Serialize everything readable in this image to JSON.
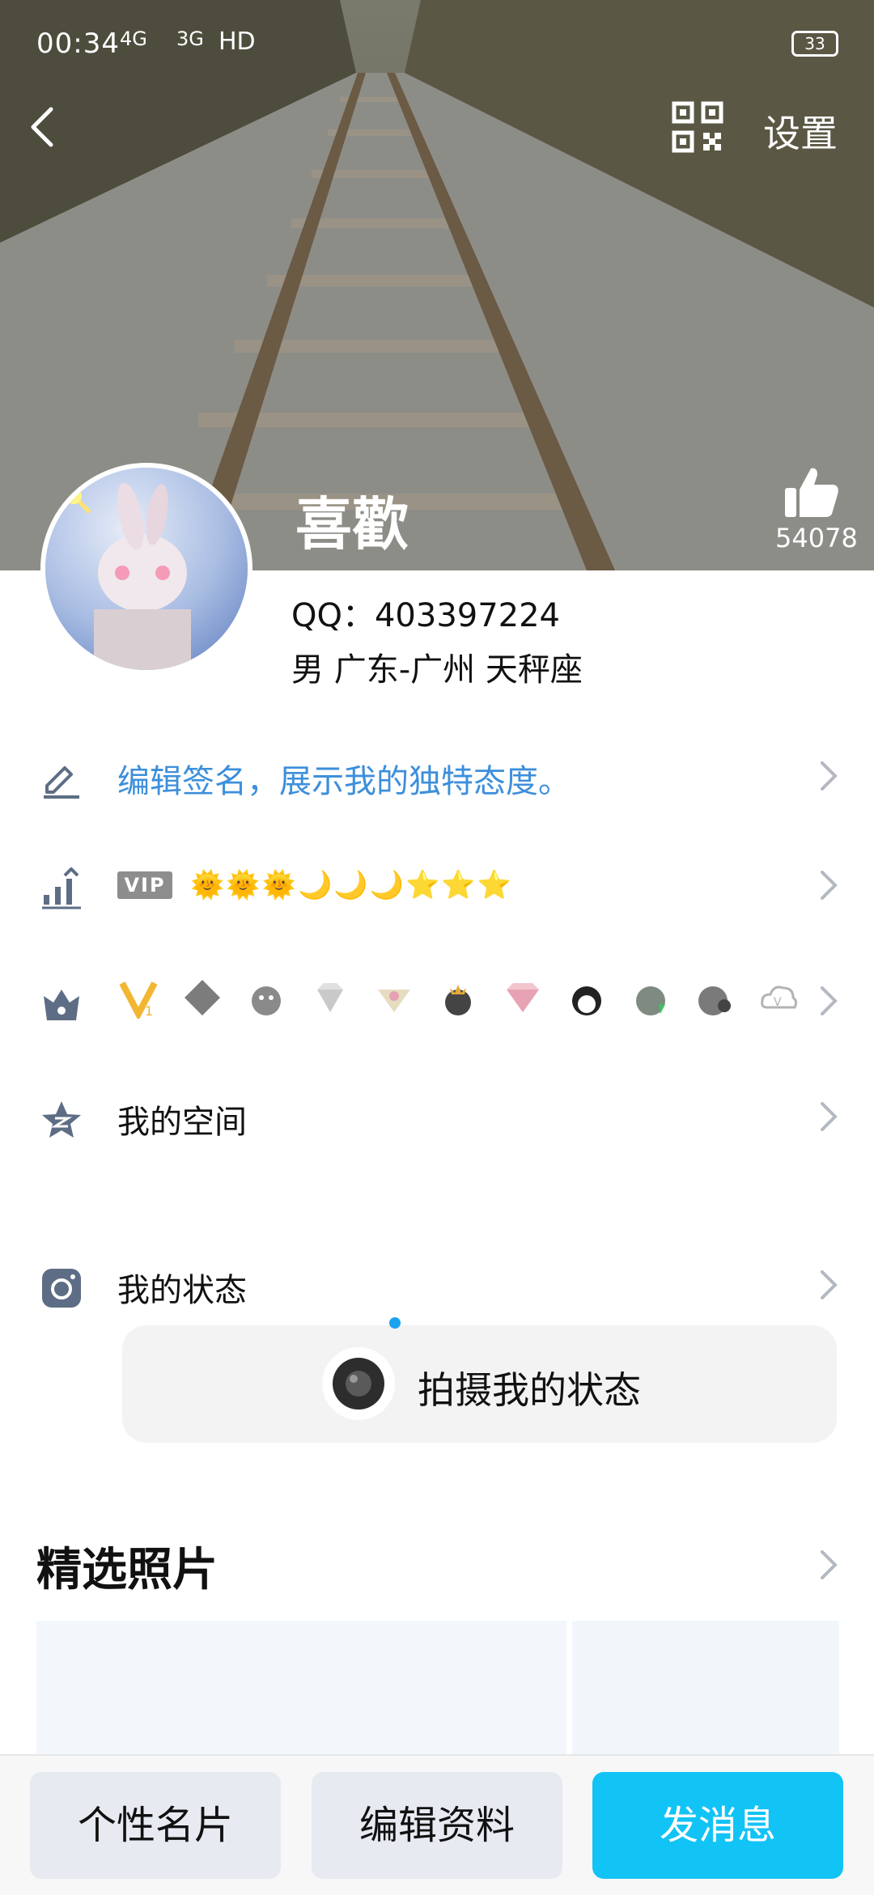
{
  "status_bar": {
    "time": "00:34",
    "network_1": "4G",
    "network_2": "3G",
    "hd": "HD",
    "battery": "33"
  },
  "top_bar": {
    "back_icon": "chevron-left-icon",
    "qr_icon": "qr-code-icon",
    "settings_label": "设置"
  },
  "profile": {
    "nickname": "喜歡",
    "like_count": "54078",
    "qq_line": "QQ：403397224",
    "info_line": "男  广东-广州  天秤座"
  },
  "rows": {
    "signature": "编辑签名，展示我的独特态度。",
    "vip_badge": "VIP",
    "level_icons": "🌞🌞🌞🌙🌙🌙⭐⭐⭐",
    "my_space": "我的空间",
    "my_status": "我的状态"
  },
  "status_card": {
    "label": "拍摄我的状态"
  },
  "photos": {
    "title": "精选照片"
  },
  "buttons": {
    "card": "个性名片",
    "edit": "编辑资料",
    "message": "发消息"
  },
  "colors": {
    "accent": "#12c3f5",
    "signature_text": "#3d8fdb"
  }
}
